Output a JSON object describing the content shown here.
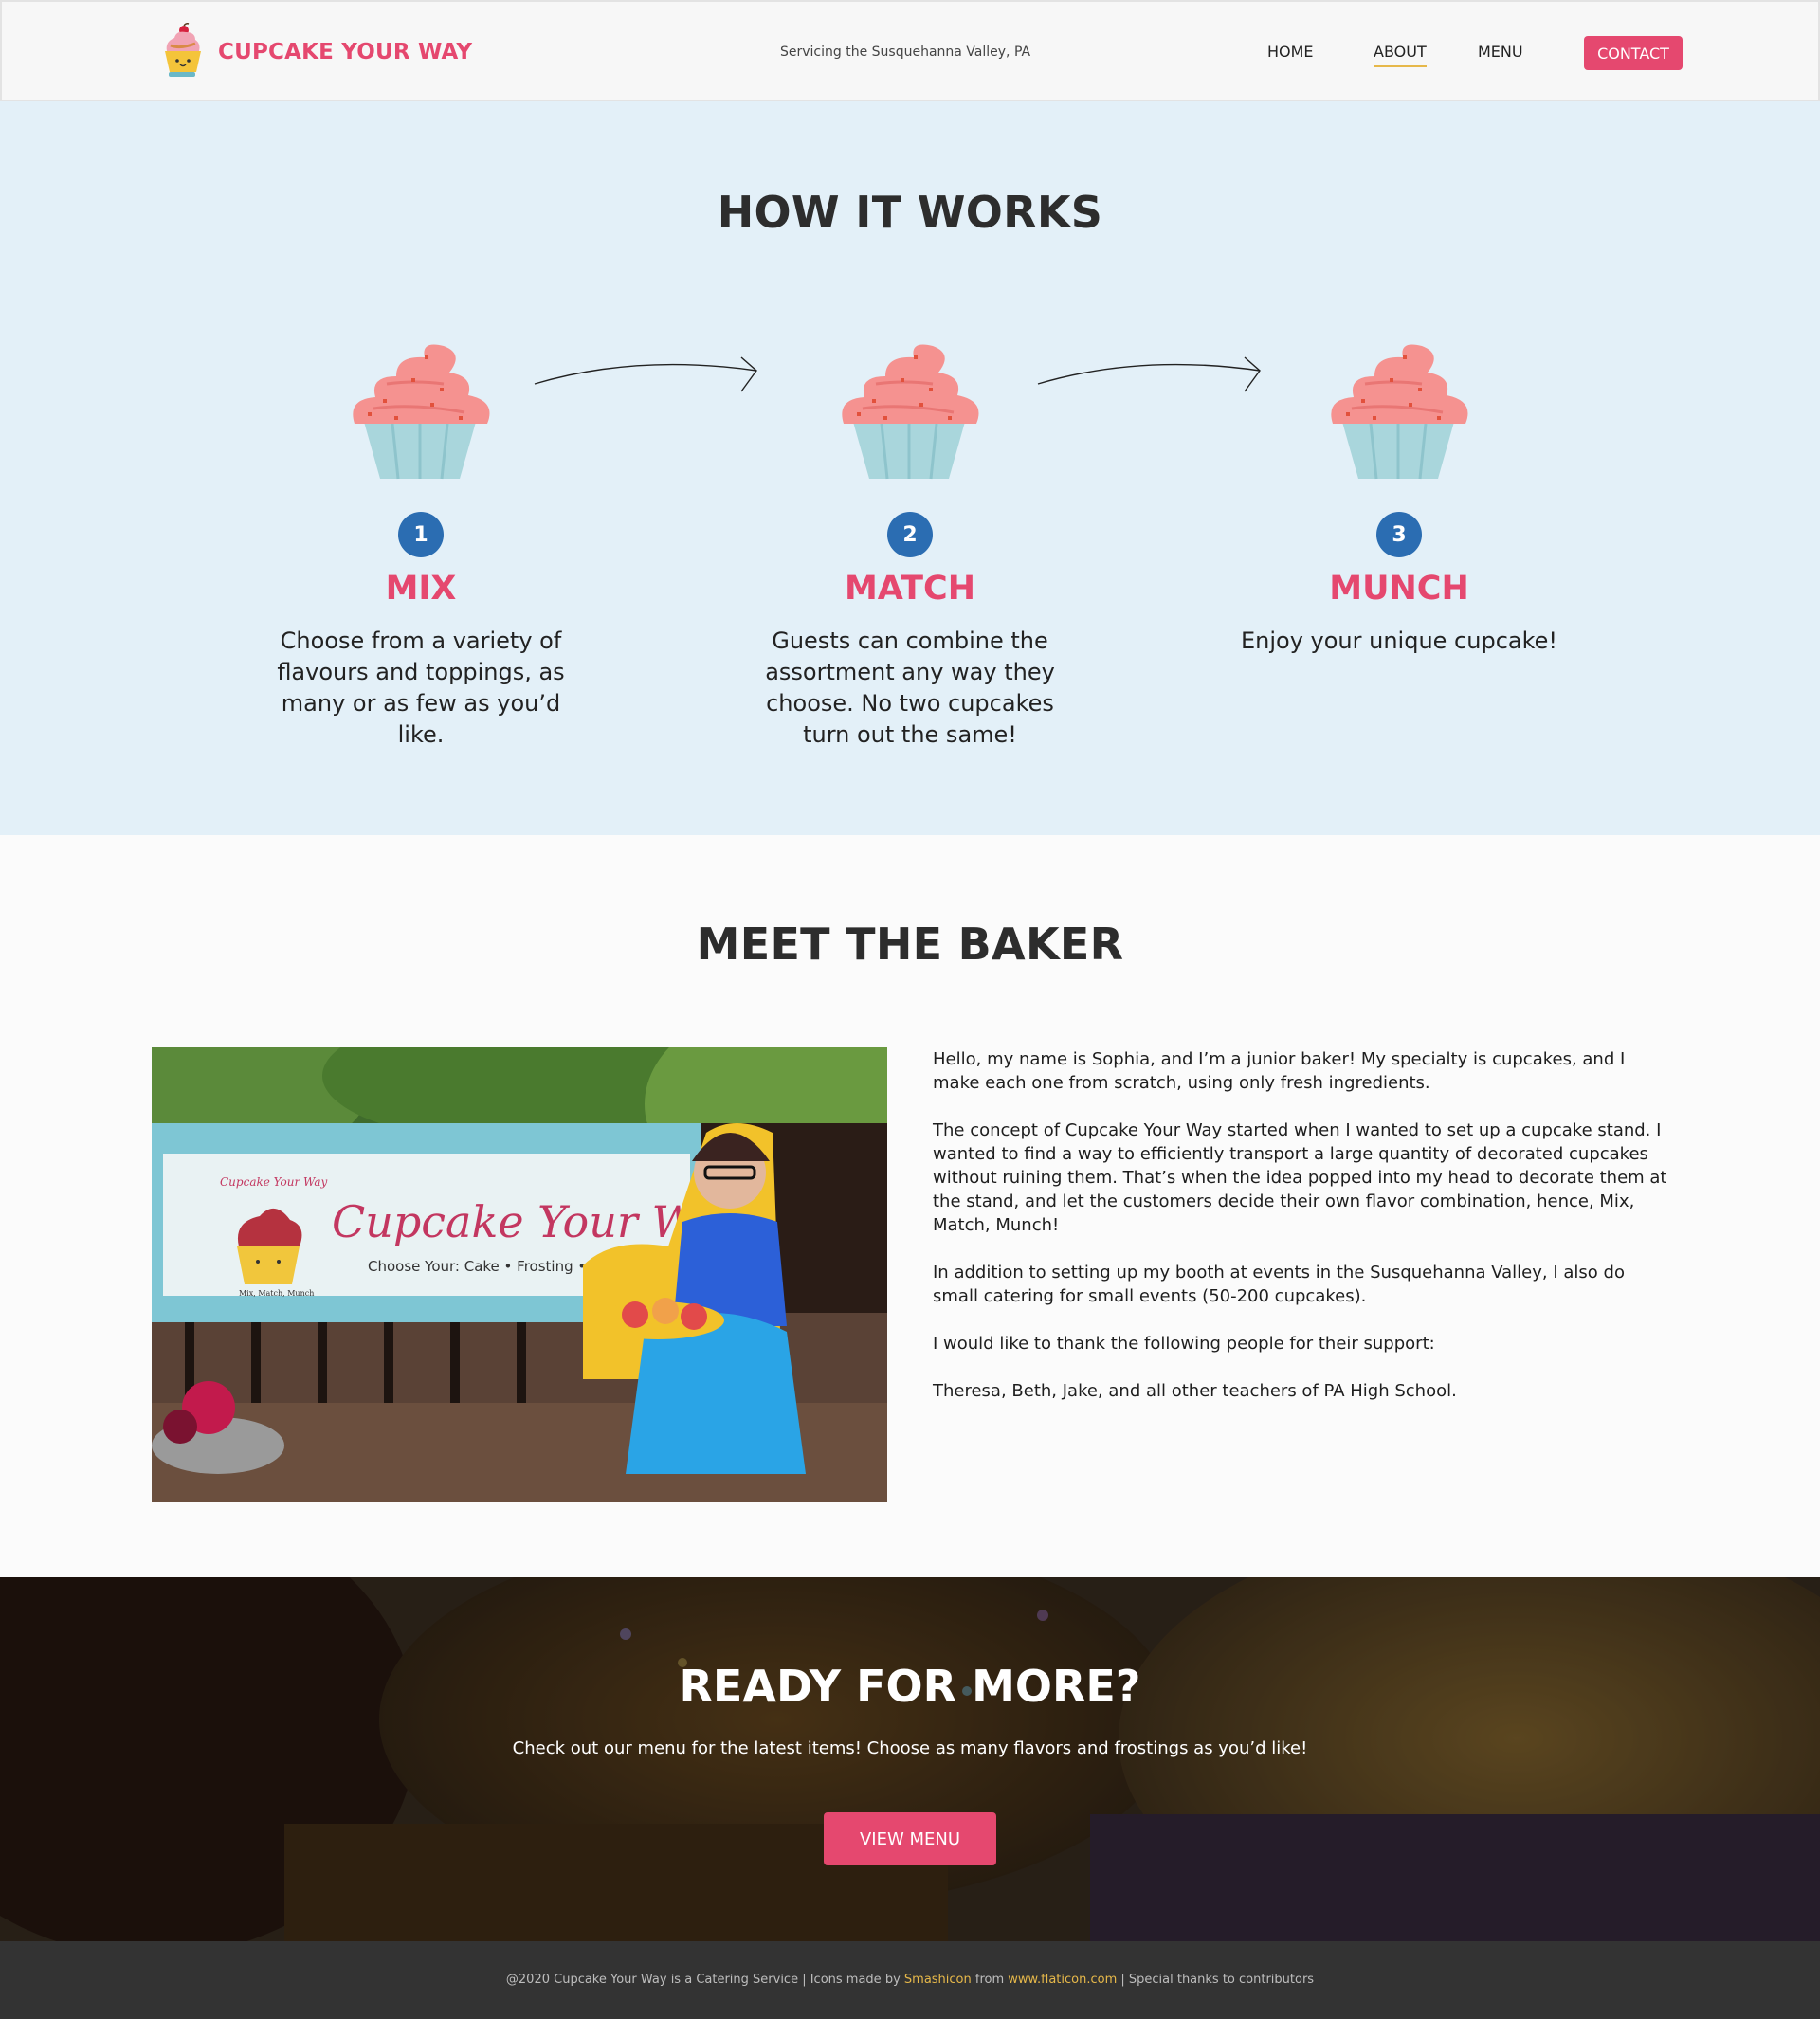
{
  "header": {
    "brand": "CUPCAKE YOUR WAY",
    "tagline": "Servicing the Susquehanna Valley, PA",
    "nav": [
      "HOME",
      "ABOUT",
      "MENU"
    ],
    "active_nav": "ABOUT",
    "contact_label": "CONTACT"
  },
  "how_it_works": {
    "title": "HOW IT WORKS",
    "steps": [
      {
        "number": "1",
        "title": "MIX",
        "text": "Choose from a variety of flavours and toppings, as many or as few as you’d like."
      },
      {
        "number": "2",
        "title": "MATCH",
        "text": "Guests can combine the assortment any way they choose. No two cupcakes turn out the same!"
      },
      {
        "number": "3",
        "title": "MUNCH",
        "text": "Enjoy your unique cupcake!"
      }
    ]
  },
  "meet_the_baker": {
    "title": "MEET THE BAKER",
    "photo_banner": {
      "brand_script": "Cupcake Your Way",
      "small_script": "Cupcake Your Way",
      "subtitle": "Choose Your: Cake • Frosting • Toppings",
      "motto": "Mix, Match, Munch"
    },
    "paragraphs": [
      "Hello, my name is Sophia, and I’m a junior baker! My specialty is cupcakes, and I make each one from scratch, using only fresh ingredients.",
      "The concept of Cupcake Your Way started when I wanted to set up a cupcake stand. I wanted to find a way to efficiently transport a large quantity of decorated cupcakes without ruining them. That’s when the idea popped into my head to decorate them at the stand, and let the customers decide their own flavor combination, hence, Mix, Match, Munch!",
      "In addition to setting up my booth at events in the Susquehanna Valley, I also do small catering for small events (50-200 cupcakes).",
      "I would like to thank the following people for their support:",
      "Theresa, Beth, Jake, and all other teachers of PA High School."
    ]
  },
  "ready": {
    "title": "READY FOR MORE?",
    "text": "Check out our menu for the latest items! Choose as many flavors and frostings as you’d like!",
    "button_label": "VIEW MENU"
  },
  "footer": {
    "prefix": "@2020 Cupcake Your Way is a Catering Service | Icons made by ",
    "author": "Smashicon",
    "from": " from ",
    "site": "www.flaticon.com",
    "suffix": " | Special thanks to contributors"
  },
  "colors": {
    "accent": "#e5486f",
    "step_number": "#2b6db2",
    "how_bg": "#e3f0f8",
    "footer_bg": "#333333",
    "nav_underline": "#e6b84a"
  },
  "icons": [
    "cupcake-logo-icon",
    "cupcake-icon",
    "curved-arrow-icon"
  ]
}
